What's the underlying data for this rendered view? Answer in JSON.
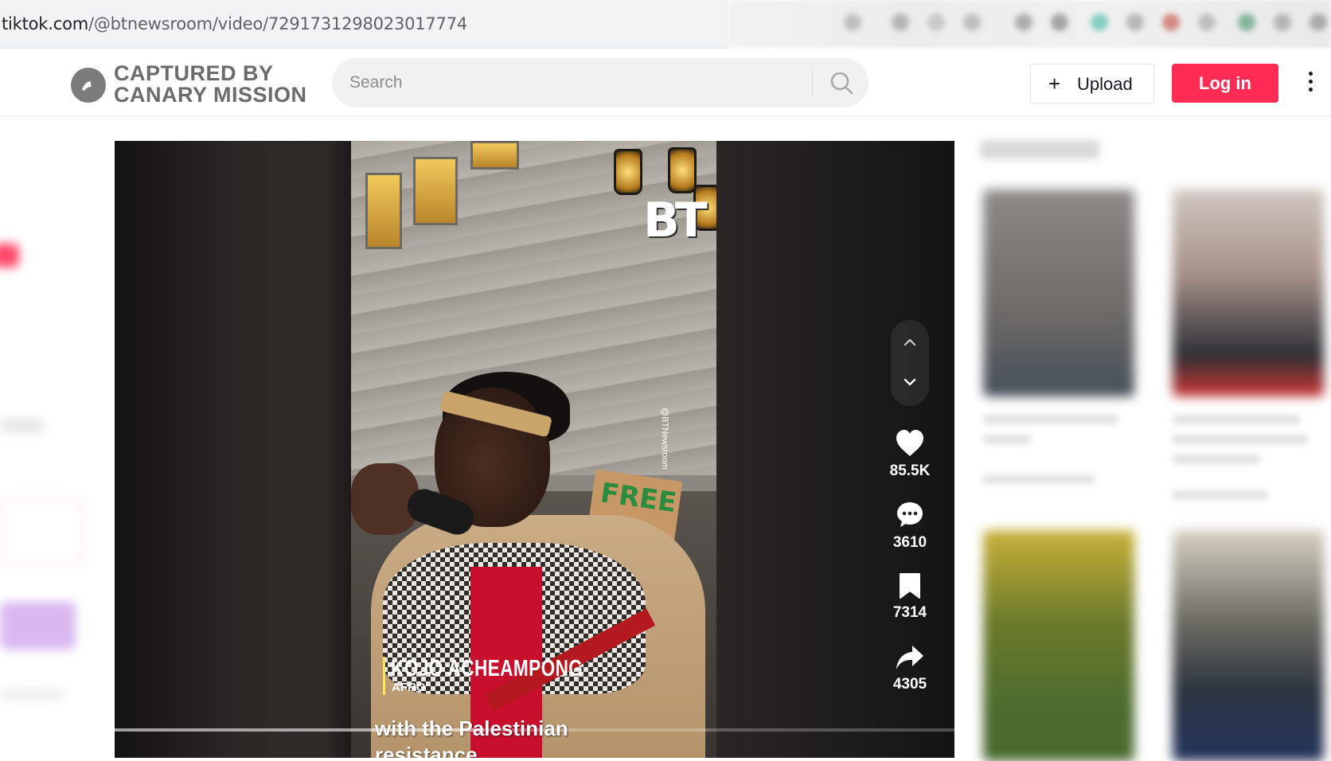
{
  "browser": {
    "url_domain": "tiktok.com",
    "url_path": "/@btnewsroom/video/7291731298023017774"
  },
  "header": {
    "logo_line1": "CAPTURED BY",
    "logo_line2": "CANARY MISSION",
    "search_placeholder": "Search",
    "upload_label": "Upload",
    "upload_icon": "plus-icon",
    "login_label": "Log in",
    "more_icon": "vertical-dots-icon"
  },
  "video": {
    "overlay_name": "KOJO ACHEAMPONG",
    "overlay_subtitle": "AFRO",
    "caption_line1": "with the Palestinian",
    "caption_line2": "resistance",
    "watermark": "BT",
    "watermark_handle": "@BTNewsroom",
    "sign_text": "FREE",
    "progress": 0.44
  },
  "actions": {
    "likes": "85.5K",
    "comments": "3610",
    "saves": "7314",
    "shares": "4305",
    "like_icon": "heart-icon",
    "comment_icon": "comment-icon",
    "save_icon": "bookmark-icon",
    "share_icon": "share-icon"
  },
  "colors": {
    "brand_red": "#fe2c55",
    "logo_gray": "#6b6b6b"
  }
}
